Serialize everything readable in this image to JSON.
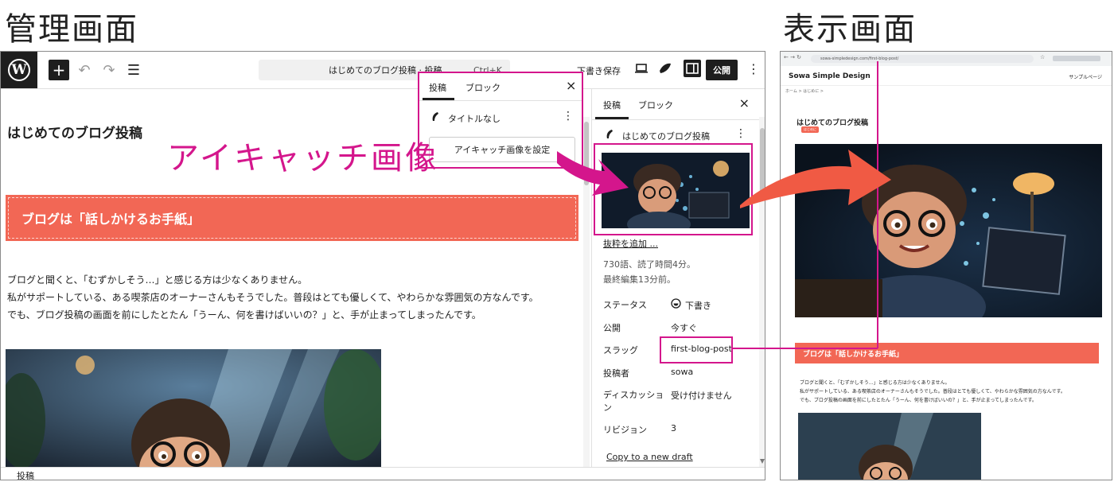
{
  "labels": {
    "admin_screen": "管理画面",
    "view_screen": "表示画面",
    "eyecatch": "アイキャッチ画像",
    "slug": "スラッグ"
  },
  "editor": {
    "toolbar": {
      "add": "+",
      "undo": "↶",
      "redo": "↷",
      "outline": "☰",
      "command_title": "はじめてのブログ投稿 · 投稿",
      "shortcut": "Ctrl+K",
      "save_draft": "下書き保存",
      "publish": "公開",
      "more": "⋮"
    },
    "post_title": "はじめてのブログ投稿",
    "heading_block": "ブログは「話しかけるお手紙」",
    "paragraphs": [
      "ブログと聞くと、「むずかしそう…」と感じる方は少なくありません。",
      "私がサポートしている、ある喫茶店のオーナーさんもそうでした。普段はとても優しくて、やわらかな雰囲気の方なんです。",
      "でも、ブログ投稿の画面を前にしたとたん「うーん、何を書けばいいの？」と、手が止まってしまったんです。"
    ],
    "status_bar": "投稿"
  },
  "popup": {
    "tab_post": "投稿",
    "tab_block": "ブロック",
    "close": "×",
    "post_title": "タイトルなし",
    "more": "⋮",
    "set_featured": "アイキャッチ画像を設定"
  },
  "sidebar": {
    "tab_post": "投稿",
    "tab_block": "ブロック",
    "close": "×",
    "post_title": "はじめてのブログ投稿",
    "more": "⋮",
    "excerpt_link": "抜粋を追加 ...",
    "word_count": "730語、読了時間4分。",
    "last_edited": "最終編集13分前。",
    "rows": [
      {
        "label": "ステータス",
        "value": "下書き"
      },
      {
        "label": "公開",
        "value": "今すぐ"
      },
      {
        "label": "スラッグ",
        "value": "first-blog-post"
      },
      {
        "label": "投稿者",
        "value": "sowa"
      },
      {
        "label": "ディスカッション",
        "value": "受け付けません"
      },
      {
        "label": "リビジョン",
        "value": "3"
      }
    ],
    "copy_draft": "Copy to a new draft"
  },
  "browser": {
    "url": "sowa-simpledesign.com/first-blog-post/",
    "site_name": "Sowa Simple Design",
    "nav_sample": "サンプルページ",
    "breadcrumb": "ホーム  >  はじめに  >",
    "post_title": "はじめてのブログ投稿",
    "category": "はじめに",
    "heading": "ブログは「話しかけるお手紙」",
    "paragraphs": [
      "ブログと聞くと、「むずかしそう…」と感じる方は少なくありません。",
      "私がサポートしている、ある喫茶店のオーナーさんもそうでした。普段はとても優しくて、やわらかな雰囲気の方なんです。",
      "でも、ブログ投稿の画面を前にしたとたん「うーん、何を書けばいいの？」と、手が止まってしまったんです。"
    ]
  },
  "colors": {
    "accent_pink": "#d4168c",
    "heading_red": "#f26755",
    "arrow_red": "#f05a44",
    "wp_dark": "#1e1e1e"
  }
}
